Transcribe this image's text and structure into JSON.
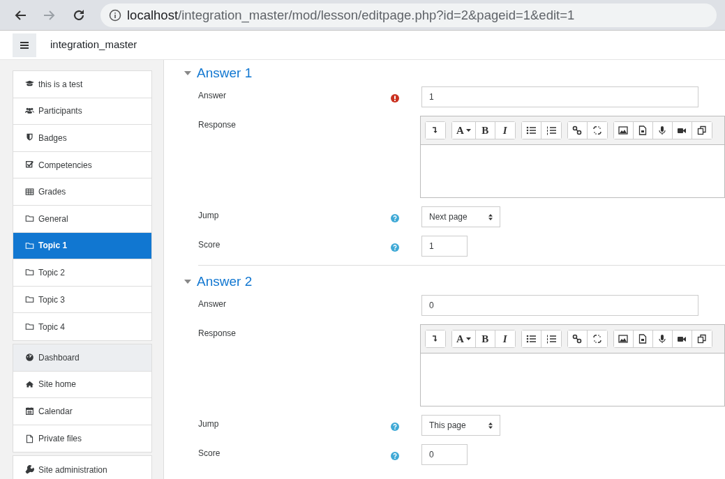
{
  "browser": {
    "url_host": "localhost",
    "url_path": "/integration_master/mod/lesson/editpage.php?id=2&pageid=1&edit=1",
    "forward_disabled": true
  },
  "navbar": {
    "title": "integration_master"
  },
  "sidebar": {
    "groups": [
      [
        {
          "label": "this is a test",
          "kind": "course",
          "selected": false,
          "hovered": false
        },
        {
          "label": "Participants",
          "kind": "participants",
          "selected": false,
          "hovered": false
        },
        {
          "label": "Badges",
          "kind": "badges",
          "selected": false,
          "hovered": false
        },
        {
          "label": "Competencies",
          "kind": "competencies",
          "selected": false,
          "hovered": false
        },
        {
          "label": "Grades",
          "kind": "grades",
          "selected": false,
          "hovered": false
        },
        {
          "label": "General",
          "kind": "section",
          "selected": false,
          "hovered": false
        },
        {
          "label": "Topic 1",
          "kind": "section",
          "selected": true,
          "hovered": false
        },
        {
          "label": "Topic 2",
          "kind": "section",
          "selected": false,
          "hovered": false
        },
        {
          "label": "Topic 3",
          "kind": "section",
          "selected": false,
          "hovered": false
        },
        {
          "label": "Topic 4",
          "kind": "section",
          "selected": false,
          "hovered": false
        }
      ],
      [
        {
          "label": "Dashboard",
          "kind": "dashboard",
          "selected": false,
          "hovered": true
        },
        {
          "label": "Site home",
          "kind": "home",
          "selected": false,
          "hovered": false
        },
        {
          "label": "Calendar",
          "kind": "calendar",
          "selected": false,
          "hovered": false
        },
        {
          "label": "Private files",
          "kind": "files",
          "selected": false,
          "hovered": false
        }
      ],
      [
        {
          "label": "Site administration",
          "kind": "admin",
          "selected": false,
          "hovered": false
        }
      ]
    ]
  },
  "sections": [
    {
      "title": "Answer 1",
      "expanded": true,
      "answer": {
        "label": "Answer",
        "value": "1",
        "required": true
      },
      "response": {
        "label": "Response",
        "toolbar": [
          [
            {
              "kind": "collapse"
            }
          ],
          [
            {
              "kind": "font",
              "label": "A"
            },
            {
              "kind": "bold",
              "label": "B"
            },
            {
              "kind": "italic",
              "label": "I"
            }
          ],
          [
            {
              "kind": "bullets"
            },
            {
              "kind": "numbers"
            }
          ],
          [
            {
              "kind": "link"
            },
            {
              "kind": "unlink"
            }
          ],
          [
            {
              "kind": "image"
            },
            {
              "kind": "media"
            },
            {
              "kind": "record"
            },
            {
              "kind": "video"
            },
            {
              "kind": "paste"
            }
          ]
        ]
      },
      "jump": {
        "label": "Jump",
        "value": "Next page",
        "help": true
      },
      "score": {
        "label": "Score",
        "value": "1",
        "help": true
      }
    },
    {
      "title": "Answer 2",
      "expanded": true,
      "answer": {
        "label": "Answer",
        "value": "0",
        "required": false
      },
      "response": {
        "label": "Response",
        "toolbar": [
          [
            {
              "kind": "collapse"
            }
          ],
          [
            {
              "kind": "font",
              "label": "A"
            },
            {
              "kind": "bold",
              "label": "B"
            },
            {
              "kind": "italic",
              "label": "I"
            }
          ],
          [
            {
              "kind": "bullets"
            },
            {
              "kind": "numbers"
            }
          ],
          [
            {
              "kind": "link"
            },
            {
              "kind": "unlink"
            }
          ],
          [
            {
              "kind": "image"
            },
            {
              "kind": "media"
            },
            {
              "kind": "record"
            },
            {
              "kind": "video"
            },
            {
              "kind": "paste"
            }
          ]
        ]
      },
      "jump": {
        "label": "Jump",
        "value": "This page",
        "help": true
      },
      "score": {
        "label": "Score",
        "value": "0",
        "help": true
      }
    }
  ]
}
